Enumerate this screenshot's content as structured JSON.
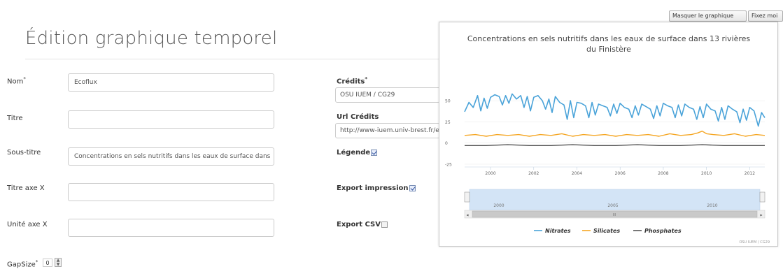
{
  "page": {
    "title": "Édition graphique temporel"
  },
  "top_buttons": {
    "hide_chart": "Masquer le graphique",
    "pin": "Fixez moi"
  },
  "form_left": [
    {
      "label": "Nom",
      "required": "*",
      "value": "Ecoflux",
      "placeholder": ""
    },
    {
      "label": "Titre",
      "required": "",
      "value": "",
      "placeholder": ""
    },
    {
      "label": "Sous-titre",
      "required": "",
      "value": "Concentrations en sels nutritifs dans les eaux de surface dans",
      "placeholder": ""
    },
    {
      "label": "Titre axe X",
      "required": "",
      "value": "",
      "placeholder": ""
    },
    {
      "label": "Unité axe X",
      "required": "",
      "value": "",
      "placeholder": ""
    }
  ],
  "form_right": {
    "credits_label": "Crédits",
    "credits_required": "*",
    "credits_value": "OSU IUEM / CG29",
    "url_label": "Url Crédits",
    "url_value": "http://www-iuem.univ-brest.fr/ec",
    "legend_label": "Légende",
    "legend_checked": true,
    "export_print_label": "Export impression",
    "export_print_checked": true,
    "export_csv_label": "Export CSV",
    "export_csv_checked": false
  },
  "gapsize": {
    "label": "GapSize",
    "required": "*",
    "value": "0"
  },
  "chart": {
    "credits": "OSU IUEM / CG29",
    "navigator_labels": [
      "2000",
      "2005",
      "2010"
    ],
    "navigator_scroll_label": "III"
  },
  "chart_data": {
    "type": "line",
    "title": "Concentrations en sels nutritifs dans les eaux de surface dans 13 rivières du Finistère",
    "xlabel": "",
    "ylabel": "",
    "xlim": [
      1998.8,
      2012.7
    ],
    "ylim": [
      -25,
      60
    ],
    "y_ticks": [
      "50",
      "25",
      "0",
      "-25"
    ],
    "y_tick_values": [
      50,
      25,
      0,
      -25
    ],
    "x_ticks": [
      "2000",
      "2002",
      "2004",
      "2006",
      "2008",
      "2010",
      "2012"
    ],
    "x_tick_values": [
      2000,
      2002,
      2004,
      2006,
      2008,
      2010,
      2012
    ],
    "grid": true,
    "legend_position": "bottom",
    "colors": {
      "Nitrates": "#4aa3d9",
      "Silicates": "#f5a623",
      "Phosphates": "#555555"
    },
    "series": [
      {
        "name": "Nitrates",
        "x": [
          1998.8,
          1999.0,
          1999.2,
          1999.4,
          1999.55,
          1999.7,
          1999.85,
          2000.0,
          2000.2,
          2000.4,
          2000.55,
          2000.7,
          2000.85,
          2001.0,
          2001.2,
          2001.4,
          2001.55,
          2001.7,
          2001.85,
          2002.0,
          2002.2,
          2002.4,
          2002.55,
          2002.7,
          2002.85,
          2003.0,
          2003.2,
          2003.4,
          2003.55,
          2003.7,
          2003.85,
          2004.0,
          2004.2,
          2004.4,
          2004.55,
          2004.7,
          2004.85,
          2005.0,
          2005.2,
          2005.4,
          2005.55,
          2005.7,
          2005.85,
          2006.0,
          2006.2,
          2006.4,
          2006.55,
          2006.7,
          2006.85,
          2007.0,
          2007.2,
          2007.4,
          2007.55,
          2007.7,
          2007.85,
          2008.0,
          2008.2,
          2008.4,
          2008.55,
          2008.7,
          2008.85,
          2009.0,
          2009.2,
          2009.4,
          2009.55,
          2009.7,
          2009.85,
          2010.0,
          2010.2,
          2010.4,
          2010.55,
          2010.7,
          2010.85,
          2011.0,
          2011.2,
          2011.4,
          2011.55,
          2011.7,
          2011.85,
          2012.0,
          2012.2,
          2012.4,
          2012.55,
          2012.7
        ],
        "values": [
          37,
          48,
          42,
          56,
          38,
          53,
          41,
          54,
          57,
          55,
          45,
          56,
          47,
          58,
          52,
          56,
          42,
          55,
          38,
          54,
          56,
          50,
          40,
          52,
          36,
          55,
          48,
          45,
          28,
          50,
          30,
          48,
          47,
          44,
          30,
          48,
          33,
          46,
          44,
          42,
          32,
          46,
          35,
          47,
          42,
          40,
          30,
          44,
          33,
          46,
          43,
          40,
          29,
          44,
          32,
          47,
          44,
          42,
          30,
          45,
          32,
          46,
          42,
          40,
          28,
          43,
          30,
          46,
          40,
          38,
          26,
          42,
          28,
          44,
          40,
          37,
          24,
          40,
          27,
          42,
          38,
          20,
          36,
          30
        ]
      },
      {
        "name": "Silicates",
        "x": [
          1998.8,
          1999.3,
          1999.8,
          2000.3,
          2000.8,
          2001.3,
          2001.8,
          2002.3,
          2002.8,
          2003.3,
          2003.8,
          2004.3,
          2004.8,
          2005.3,
          2005.8,
          2006.3,
          2006.8,
          2007.3,
          2007.8,
          2008.3,
          2008.8,
          2009.3,
          2009.6,
          2009.8,
          2010.0,
          2010.3,
          2010.8,
          2011.3,
          2011.8,
          2012.3,
          2012.7
        ],
        "values": [
          9,
          10,
          8,
          10,
          9,
          10,
          8,
          10,
          9,
          11,
          8,
          10,
          9,
          10,
          8,
          10,
          9,
          10,
          8,
          11,
          9,
          10,
          12,
          14,
          11,
          10,
          9,
          11,
          8,
          10,
          9
        ]
      },
      {
        "name": "Phosphates",
        "x": [
          1998.8,
          1999.8,
          2000.8,
          2001.8,
          2002.8,
          2003.8,
          2004.8,
          2005.8,
          2006.8,
          2007.8,
          2008.8,
          2009.8,
          2010.8,
          2011.8,
          2012.7
        ],
        "values": [
          -3,
          -3,
          -2,
          -3,
          -3,
          -2,
          -3,
          -3,
          -2,
          -3,
          -3,
          -2,
          -3,
          -3,
          -3
        ]
      }
    ]
  }
}
